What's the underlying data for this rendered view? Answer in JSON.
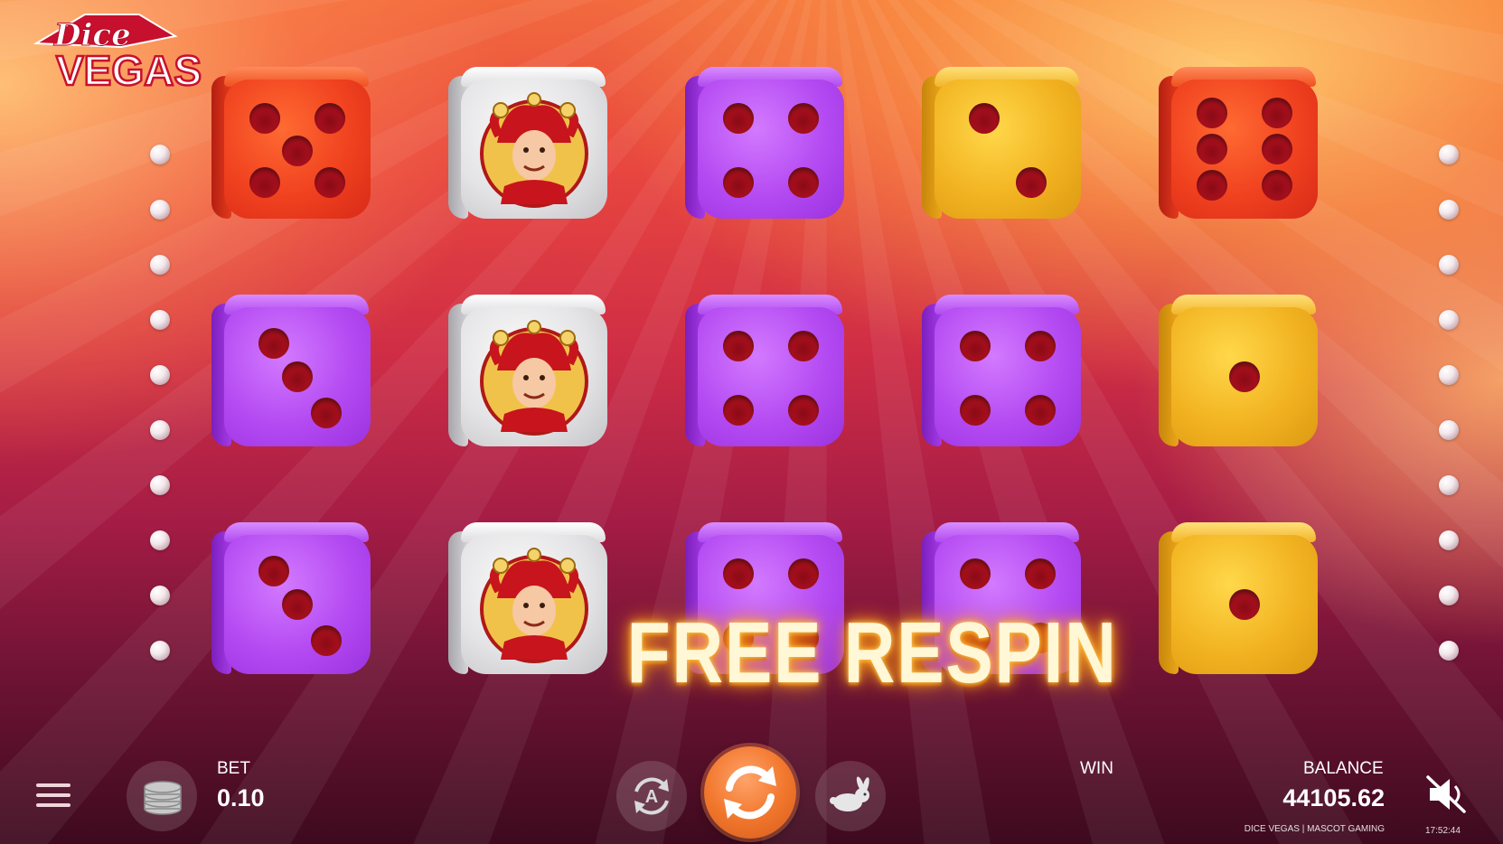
{
  "game": {
    "logo_script": "Dice",
    "logo_main": "VEGAS",
    "banner": "FREE RESPIN"
  },
  "grid": {
    "rows": [
      [
        {
          "color": "red",
          "pips": 5
        },
        {
          "color": "jester",
          "pips": 0
        },
        {
          "color": "purple",
          "pips": 4
        },
        {
          "color": "yellow",
          "pips": 2
        },
        {
          "color": "red",
          "pips": 6
        }
      ],
      [
        {
          "color": "purple",
          "pips": 3
        },
        {
          "color": "jester",
          "pips": 0
        },
        {
          "color": "purple",
          "pips": 4
        },
        {
          "color": "purple",
          "pips": 4
        },
        {
          "color": "yellow",
          "pips": 1
        }
      ],
      [
        {
          "color": "purple",
          "pips": 3
        },
        {
          "color": "jester",
          "pips": 0
        },
        {
          "color": "purple",
          "pips": 4
        },
        {
          "color": "purple",
          "pips": 4
        },
        {
          "color": "yellow",
          "pips": 1
        }
      ]
    ]
  },
  "controls": {
    "bet_label": "BET",
    "bet_value": "0.10",
    "win_label": "WIN",
    "balance_label": "BALANCE",
    "balance_value": "44105.62",
    "autoplay_letter": "A",
    "footer": "DICE VEGAS | MASCOT GAMING",
    "clock": "17:52:44"
  },
  "icons": [
    "menu-icon",
    "coins-icon",
    "autoplay-icon",
    "spin-icon",
    "turbo-rabbit-icon",
    "sound-muted-icon"
  ],
  "colors": {
    "red": "#f0411f",
    "purple": "#b44af2",
    "yellow": "#f2b321",
    "pip": "#a8101d",
    "spin": "#f2782e"
  }
}
